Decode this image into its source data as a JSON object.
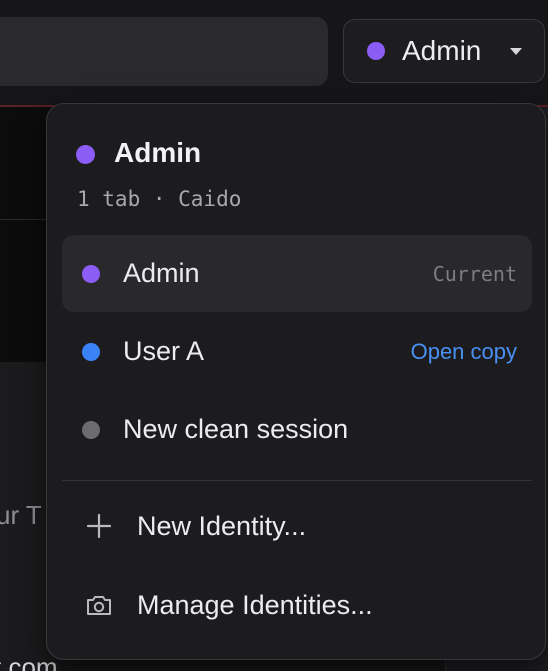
{
  "background": {
    "partial_text_left": "ur T",
    "partial_text_bottom": "t.com"
  },
  "identity_selector": {
    "label": "Admin",
    "dot_color": "#8b5cf6",
    "icon": "chevron-down-icon"
  },
  "menu": {
    "header": {
      "title": "Admin",
      "subtitle": "1 tab · Caido",
      "dot_color": "#8b5cf6"
    },
    "identities": [
      {
        "label": "Admin",
        "dot_color": "#8b5cf6",
        "meta": "Current",
        "active": true
      },
      {
        "label": "User A",
        "dot_color": "#3b82f6",
        "meta": "Open copy",
        "active": false
      },
      {
        "label": "New clean session",
        "dot_color": "#6b6b70",
        "meta": "",
        "active": false
      }
    ],
    "actions": [
      {
        "label": "New Identity...",
        "icon": "plus-icon"
      },
      {
        "label": "Manage Identities...",
        "icon": "camera-icon"
      }
    ]
  },
  "colors": {
    "accent_blue": "#4a8ff2",
    "admin_purple": "#8b5cf6",
    "user_blue": "#3b82f6",
    "clean_gray": "#6b6b70"
  }
}
